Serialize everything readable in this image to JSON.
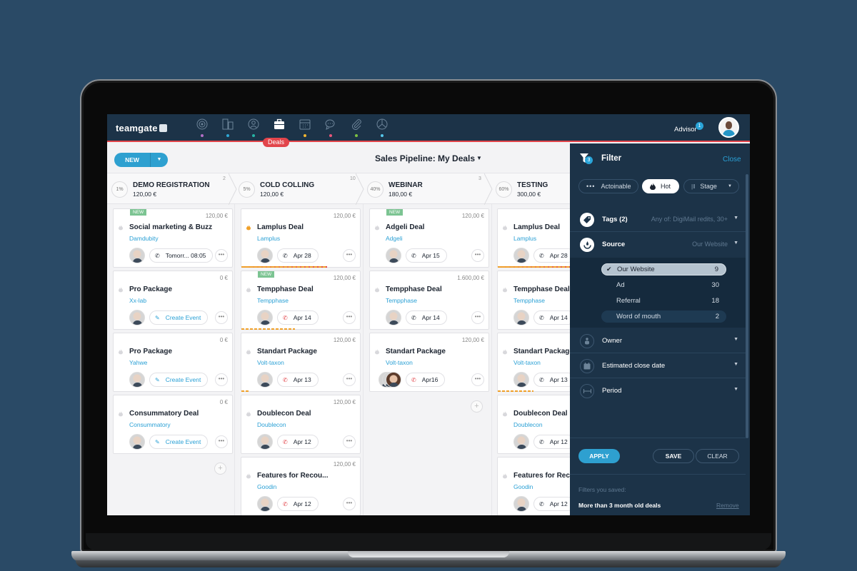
{
  "app": {
    "logo": "teamgate",
    "nav": [
      {
        "icon": "target-icon",
        "dot": "#b36fc7"
      },
      {
        "icon": "buildings-icon",
        "dot": "#2ea8d6"
      },
      {
        "icon": "contact-icon",
        "dot": "#26b3a5"
      },
      {
        "icon": "briefcase-icon",
        "dot": "",
        "active": true
      },
      {
        "icon": "calendar-icon",
        "dot": "#f1b631"
      },
      {
        "icon": "chat-icon",
        "dot": "#e8577a"
      },
      {
        "icon": "paperclip-icon",
        "dot": "#7cc142"
      },
      {
        "icon": "pie-chart-icon",
        "dot": "#55c7ea"
      }
    ],
    "active_nav_label": "Deals",
    "user": {
      "name": "Advisor",
      "notifications": "1"
    }
  },
  "toolbar": {
    "new_label": "NEW",
    "pipeline_title": "Sales Pipeline: My Deals"
  },
  "stages": [
    {
      "pct": "1%",
      "name": "DEMO REGISTRATION",
      "value": "120,00 €",
      "count": "2"
    },
    {
      "pct": "5%",
      "name": "COLD COLLING",
      "value": "120,00 €",
      "count": "10"
    },
    {
      "pct": "40%",
      "name": "WEBINAR",
      "value": "180,00 €",
      "count": "3"
    },
    {
      "pct": "60%",
      "name": "TESTING",
      "value": "300,00 €",
      "count": ""
    }
  ],
  "columns": [
    {
      "cards": [
        {
          "new": true,
          "amount": "120,00 €",
          "title": "Social marketing & Buzz",
          "company": "Damdubity",
          "activity": "Tomorr... 08:05",
          "activity_type": "call",
          "hot": false
        },
        {
          "new": false,
          "amount": "0 €",
          "title": "Pro Package",
          "company": "Xx-lab",
          "activity": "Create Event",
          "activity_type": "event",
          "hot": false
        },
        {
          "new": false,
          "amount": "0 €",
          "title": "Pro Package",
          "company": "Yahwe",
          "activity": "Create Event",
          "activity_type": "event",
          "hot": false
        },
        {
          "new": false,
          "amount": "0 €",
          "title": "Consummatory Deal",
          "company": "Consummatory",
          "activity": "Create Event",
          "activity_type": "event",
          "hot": false
        }
      ]
    },
    {
      "cards": [
        {
          "new": false,
          "amount": "120,00 €",
          "title": "Lamplus Deal",
          "company": "Lamplus",
          "activity": "Apr 28",
          "activity_type": "call",
          "hot": true,
          "progress": 0.72
        },
        {
          "new": true,
          "amount": "120,00 €",
          "title": "Tempphase Deal",
          "company": "Tempphase",
          "activity": "Apr 14",
          "activity_type": "call-overdue",
          "hot": false,
          "progress": 0.45
        },
        {
          "new": false,
          "amount": "120,00 €",
          "title": "Standart Package",
          "company": "Volt-taxon",
          "activity": "Apr 13",
          "activity_type": "call-overdue",
          "hot": false,
          "progress": 0.06
        },
        {
          "new": false,
          "amount": "120,00 €",
          "title": "Doublecon Deal",
          "company": "Doublecon",
          "activity": "Apr 12",
          "activity_type": "call-overdue",
          "hot": false
        },
        {
          "new": false,
          "amount": "120,00 €",
          "title": "Features for Recou...",
          "company": "Goodin",
          "activity": "Apr 12",
          "activity_type": "call-overdue",
          "hot": false
        }
      ]
    },
    {
      "cards": [
        {
          "new": true,
          "amount": "120,00 €",
          "title": "Adgeli Deal",
          "company": "Adgeli",
          "activity": "Apr 15",
          "activity_type": "call",
          "hot": false
        },
        {
          "new": false,
          "amount": "1.600,00 €",
          "title": "Tempphase Deal",
          "company": "Tempphase",
          "activity": "Apr 14",
          "activity_type": "call",
          "hot": false
        },
        {
          "new": false,
          "amount": "120,00 €",
          "title": "Standart Package",
          "company": "Volt-taxon",
          "activity": "Apr16",
          "activity_type": "call-overdue",
          "hot": false,
          "multi_avatar": true
        }
      ]
    },
    {
      "cards": [
        {
          "new": false,
          "amount": "",
          "title": "Lamplus Deal",
          "company": "Lamplus",
          "activity": "Apr 28",
          "activity_type": "call",
          "hot": false,
          "progress": 0.7
        },
        {
          "new": false,
          "amount": "",
          "title": "Tempphase Deal",
          "company": "Tempphase",
          "activity": "Apr 14",
          "activity_type": "call",
          "hot": false
        },
        {
          "new": false,
          "amount": "",
          "title": "Standart Package",
          "company": "Volt-taxon",
          "activity": "Apr 13",
          "activity_type": "call",
          "hot": false,
          "progress": 0.3
        },
        {
          "new": false,
          "amount": "",
          "title": "Doublecon Deal",
          "company": "Doublecon",
          "activity": "Apr 12",
          "activity_type": "call",
          "hot": false
        },
        {
          "new": false,
          "amount": "",
          "title": "Features for Recou...",
          "company": "Goodin",
          "activity": "Apr 12",
          "activity_type": "call",
          "hot": false
        }
      ]
    }
  ],
  "filter": {
    "title": "Filter",
    "badge": "3",
    "close_label": "Close",
    "chips": {
      "actionable": "Actoinable",
      "hot": "Hot",
      "stage": "Stage"
    },
    "tags": {
      "label": "Tags (2)",
      "hint": "Any of:  DigiMail redits,  30+"
    },
    "source": {
      "label": "Source",
      "hint": "Our Website",
      "options": [
        {
          "name": "Our Website",
          "count": "9",
          "selected": true
        },
        {
          "name": "Ad",
          "count": "30"
        },
        {
          "name": "Referral",
          "count": "18"
        },
        {
          "name": "Word of mouth",
          "count": "2",
          "hover": true
        }
      ]
    },
    "owner_label": "Owner",
    "close_date_label": "Estimated close date",
    "period_label": "Period",
    "apply_label": "APPLY",
    "save_label": "SAVE",
    "clear_label": "CLEAR",
    "saved_label": "Filters you saved:",
    "saved_items": [
      {
        "name": "More than 3 month old deals",
        "remove": "Remove"
      }
    ]
  }
}
